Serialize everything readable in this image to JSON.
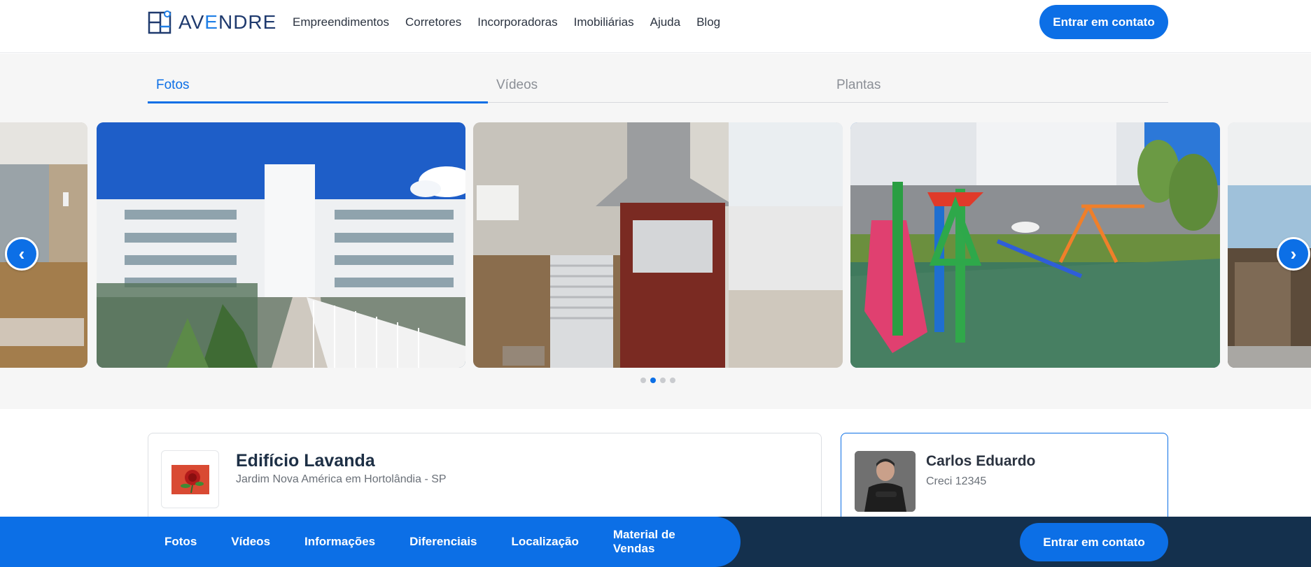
{
  "header": {
    "logo_text_pre": "AV",
    "logo_text_accent": "E",
    "logo_text_post": "NDRE",
    "nav": [
      "Empreendimentos",
      "Corretores",
      "Incorporadoras",
      "Imobiliárias",
      "Ajuda",
      "Blog"
    ],
    "cta_label": "Entrar em contato"
  },
  "gallery": {
    "tabs": [
      "Fotos",
      "Vídeos",
      "Plantas"
    ],
    "active_tab": "Fotos",
    "slides": [
      "lobby",
      "building-exterior",
      "barbecue-area",
      "playground",
      "lobby"
    ],
    "dots_count": 4,
    "active_dot": 2,
    "prev_icon": "chevron-left-icon",
    "next_icon": "chevron-right-icon"
  },
  "property": {
    "name": "Edifício Lavanda",
    "location": "Jardim Nova América em Hortolândia - SP"
  },
  "broker": {
    "name": "Carlos Eduardo",
    "creci": "Creci 12345"
  },
  "bottom_bar": {
    "nav": [
      "Fotos",
      "Vídeos",
      "Informações",
      "Diferenciais",
      "Localização",
      "Material de Vendas"
    ],
    "cta_label": "Entrar em contato"
  },
  "colors": {
    "primary": "#0c6fe6",
    "dark_navy": "#14304d",
    "logo_navy": "#1f3a6e"
  }
}
